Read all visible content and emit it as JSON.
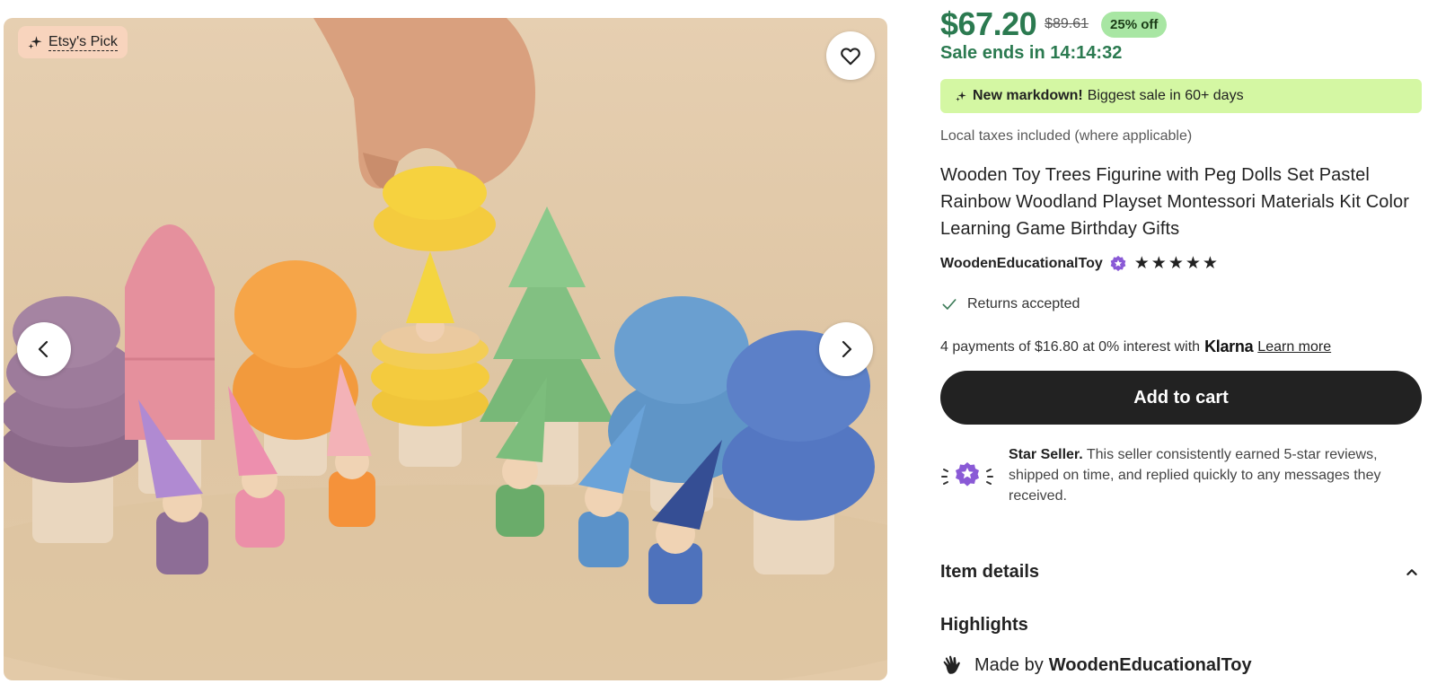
{
  "gallery": {
    "badge_label": "Etsy's Pick",
    "badge_icon": "sparkle-icon",
    "favorite_icon": "heart-icon",
    "prev_icon": "chevron-left-icon",
    "next_icon": "chevron-right-icon"
  },
  "pricing": {
    "price": "$67.20",
    "original_price": "$89.61",
    "discount": "25% off",
    "sale_ends": "Sale ends in 14:14:32",
    "markdown_bold": "New markdown!",
    "markdown_text": "Biggest sale in 60+ days",
    "taxes_note": "Local taxes included (where applicable)"
  },
  "product": {
    "title": "Wooden Toy Trees Figurine with Peg Dolls Set Pastel Rainbow Woodland Playset Montessori Materials Kit Color Learning Game Birthday Gifts",
    "seller": "WoodenEducationalToy",
    "rating_stars": "★★★★★",
    "rating_value": 5,
    "returns": "Returns accepted"
  },
  "klarna": {
    "text": "4 payments of $16.80 at 0% interest with",
    "logo": "Klarna",
    "learn_more": "Learn more"
  },
  "cart": {
    "label": "Add to cart"
  },
  "star_seller": {
    "title": "Star Seller.",
    "description": "This seller consistently earned 5-star reviews, shipped on time, and replied quickly to any messages they received."
  },
  "details": {
    "item_details": "Item details",
    "highlights": "Highlights",
    "made_by_prefix": "Made by",
    "made_by_seller": "WoodenEducationalToy"
  },
  "colors": {
    "price_green": "#2b7a50",
    "discount_bg": "#a8e6a3",
    "markdown_bg": "#d4f7a3",
    "badge_bg": "#f8d4bd",
    "star_seller_purple": "#8a5ad6",
    "button_dark": "#222222"
  }
}
